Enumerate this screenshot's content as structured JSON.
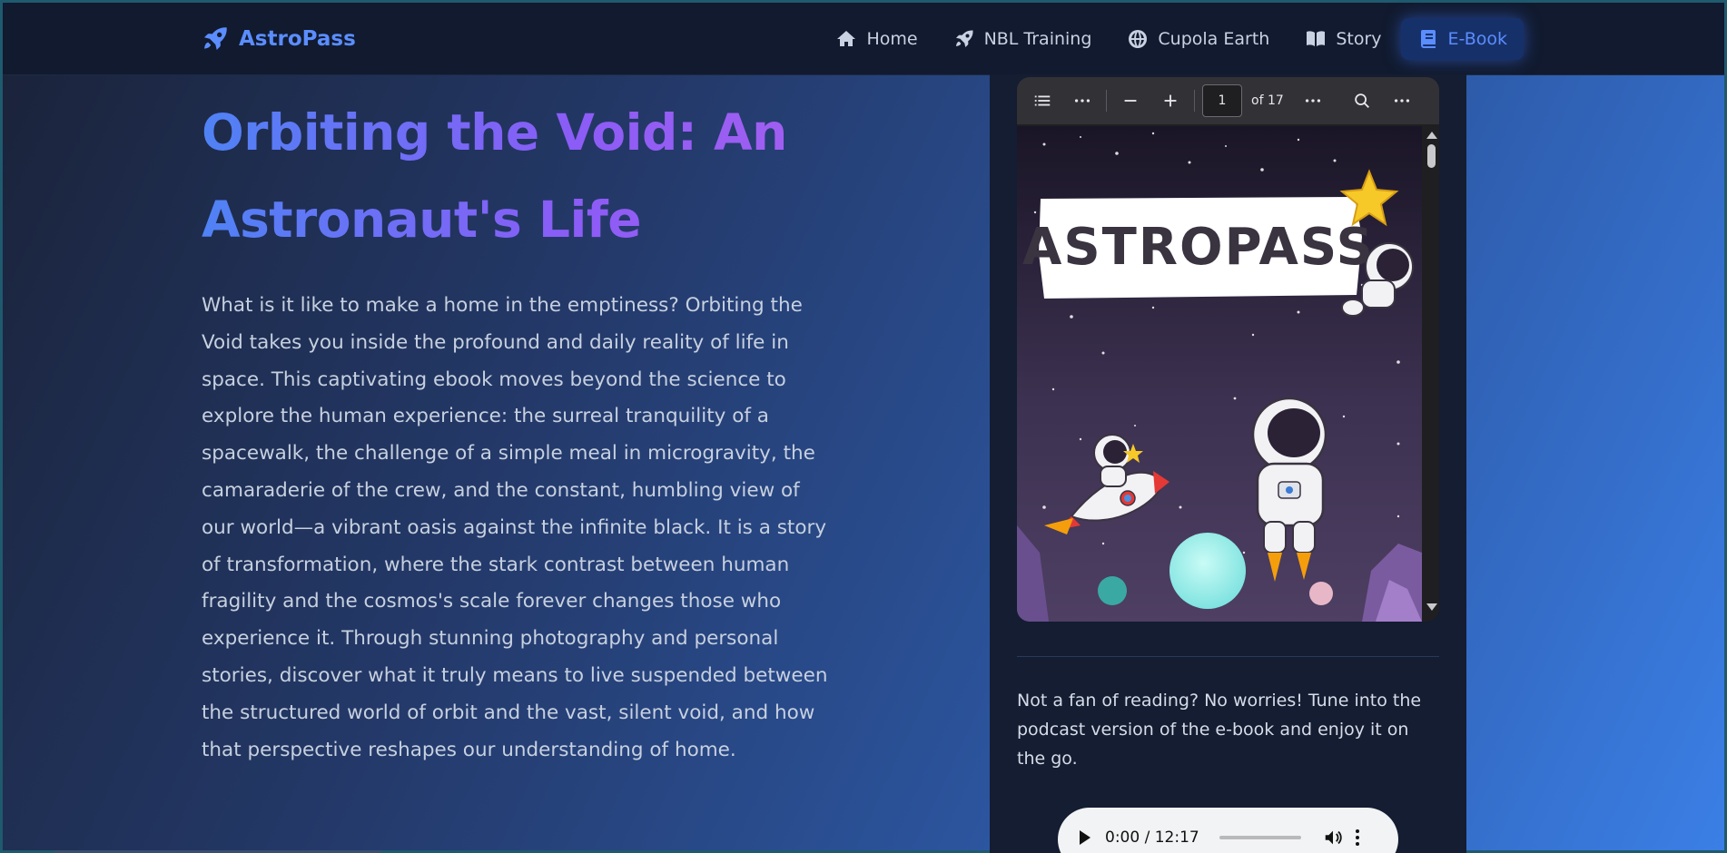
{
  "brand": {
    "name": "AstroPass",
    "icon": "rocket-icon",
    "color": "#5b8dff"
  },
  "nav": {
    "items": [
      {
        "label": "Home",
        "icon": "home-icon",
        "active": false
      },
      {
        "label": "NBL Training",
        "icon": "rocket-icon",
        "active": false
      },
      {
        "label": "Cupola Earth",
        "icon": "globe-icon",
        "active": false
      },
      {
        "label": "Story",
        "icon": "book-open-icon",
        "active": false
      },
      {
        "label": "E-Book",
        "icon": "book-icon",
        "active": true
      }
    ]
  },
  "main": {
    "title": "Orbiting the Void: An Astronaut's Life",
    "description": "What is it like to make a home in the emptiness? Orbiting the Void takes you inside the profound and daily reality of life in space. This captivating ebook moves beyond the science to explore the human experience: the surreal tranquility of a spacewalk, the challenge of a simple meal in microgravity, the camaraderie of the crew, and the constant, humbling view of our world—a vibrant oasis against the infinite black. It is a story of transformation, where the stark contrast between human fragility and the cosmos's scale forever changes those who experience it. Through stunning photography and personal stories, discover what it truly means to live suspended between the structured world of orbit and the vast, silent void, and how that perspective reshapes our understanding of home."
  },
  "pdf": {
    "current_page": "1",
    "page_count_label": "of 17",
    "cover_title": "ASTROPASS",
    "toolbar_icons": [
      "list-icon",
      "more-horizontal-icon",
      "zoom-out-icon",
      "zoom-in-icon",
      "more-horizontal-icon",
      "search-icon",
      "more-horizontal-icon"
    ]
  },
  "podcast": {
    "text": "Not a fan of reading? No worries! Tune into the podcast version of the e-book and enjoy it on the go.",
    "time": "0:00 / 12:17"
  },
  "colors": {
    "accent": "#5b8dff",
    "title_gradient_start": "#4f82f5",
    "title_gradient_end": "#a35ff0",
    "navbar_bg": "#111a2e",
    "panel_bg": "#141d31"
  }
}
